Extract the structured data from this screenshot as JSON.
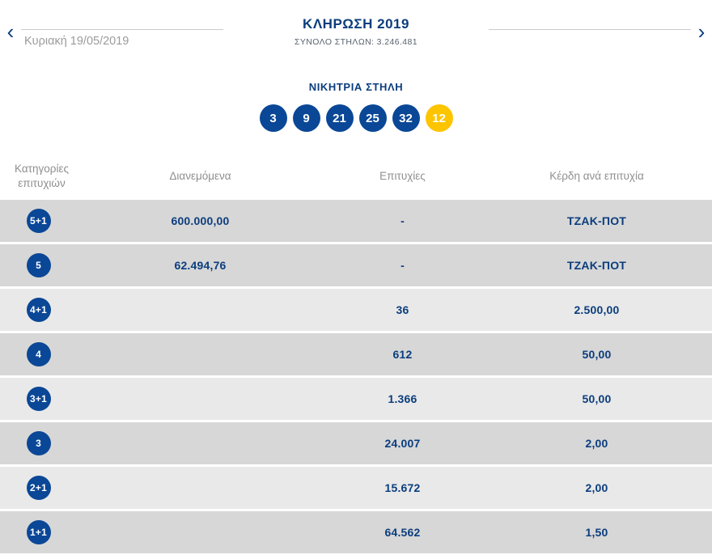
{
  "header": {
    "prev_glyph": "‹",
    "next_glyph": "›",
    "date": "Κυριακή 19/05/2019",
    "title": "ΚΛΗΡΩΣΗ 2019",
    "subtitle": "ΣΥΝΟΛΟ ΣΤΗΛΩΝ: 3.246.481"
  },
  "winning": {
    "label": "ΝΙΚΗΤΡΙΑ ΣΤΗΛΗ",
    "numbers": [
      "3",
      "9",
      "21",
      "25",
      "32"
    ],
    "joker": "12"
  },
  "colors": {
    "navy": "#0b3d7d",
    "ball-blue": "#0a4796",
    "joker-yellow": "#fdc400",
    "row-dark": "#d7d7d7",
    "row-light": "#e9e9e9",
    "header-gray": "#8f8f8f",
    "line-gray": "#cccccc",
    "subtitle-gray": "#57626e"
  },
  "table": {
    "headers": {
      "category": "Κατηγορίες επιτυχιών",
      "distributed": "Διανεμόμενα",
      "wins": "Επιτυχίες",
      "profit": "Κέρδη ανά επιτυχία"
    },
    "rows": [
      {
        "badge": "5+1",
        "distributed": "600.000,00",
        "wins": "-",
        "profit": "ΤΖΑΚ-ΠΟΤ"
      },
      {
        "badge": "5",
        "distributed": "62.494,76",
        "wins": "-",
        "profit": "ΤΖΑΚ-ΠΟΤ"
      },
      {
        "badge": "4+1",
        "distributed": "",
        "wins": "36",
        "profit": "2.500,00"
      },
      {
        "badge": "4",
        "distributed": "",
        "wins": "612",
        "profit": "50,00"
      },
      {
        "badge": "3+1",
        "distributed": "",
        "wins": "1.366",
        "profit": "50,00"
      },
      {
        "badge": "3",
        "distributed": "",
        "wins": "24.007",
        "profit": "2,00"
      },
      {
        "badge": "2+1",
        "distributed": "",
        "wins": "15.672",
        "profit": "2,00"
      },
      {
        "badge": "1+1",
        "distributed": "",
        "wins": "64.562",
        "profit": "1,50"
      }
    ]
  }
}
